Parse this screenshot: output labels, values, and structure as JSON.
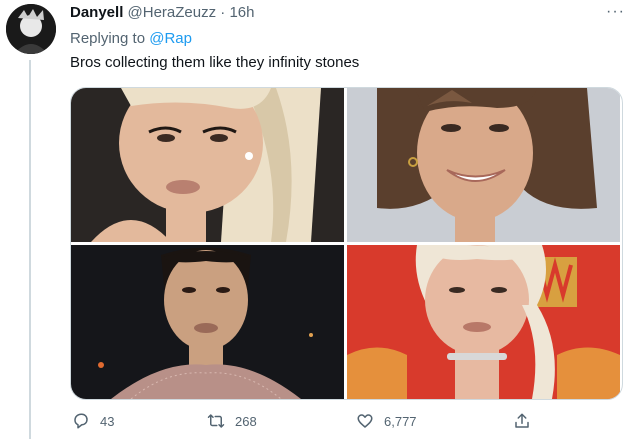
{
  "tweet": {
    "display_name": "Danyell",
    "handle": "@HeraZeuzz",
    "separator": "·",
    "time": "16h",
    "more_label": "···",
    "replying_to_prefix": "Replying to",
    "replying_to_handle": "@Rap",
    "text": "Bros collecting them like they infinity stones"
  },
  "media": {
    "photos": [
      {
        "name": "photo-1",
        "background": "#2a2624",
        "skin": "#e3b99c",
        "hair": "#ece0c8"
      },
      {
        "name": "photo-2",
        "background": "#c9cdd3",
        "skin": "#d9a98a",
        "hair": "#5a3f2d"
      },
      {
        "name": "photo-3",
        "background": "#15161a",
        "skin": "#caa080",
        "hair": "#1a1411"
      },
      {
        "name": "photo-4",
        "background": "#d83a2c",
        "skin": "#e7b9a1",
        "hair": "#efe6d6"
      }
    ]
  },
  "actions": {
    "reply_count": "43",
    "retweet_count": "268",
    "like_count": "6,777",
    "icons": [
      "reply-icon",
      "retweet-icon",
      "like-icon",
      "share-icon"
    ]
  }
}
